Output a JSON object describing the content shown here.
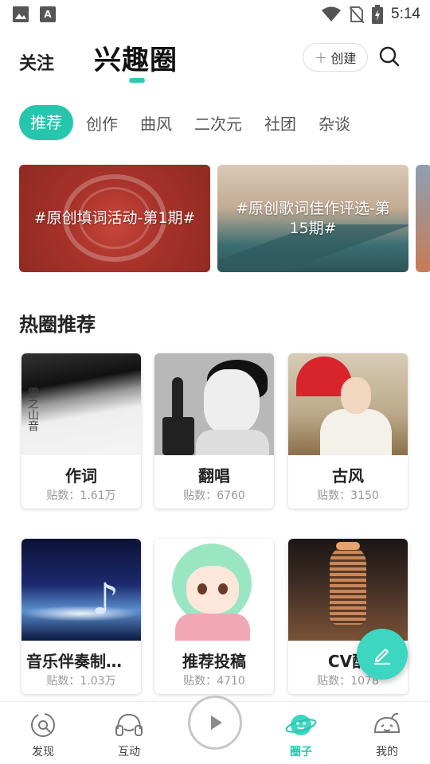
{
  "status_bar": {
    "time": "5:14",
    "left_icons": [
      "image-icon",
      "a-icon"
    ],
    "right_icons": [
      "wifi-icon",
      "no-sim-icon",
      "battery-icon"
    ]
  },
  "header": {
    "tab_follow": "关注",
    "tab_circle": "兴趣圈",
    "create_label": "创建",
    "accent_color": "#25c6ad"
  },
  "categories": [
    "推荐",
    "创作",
    "曲风",
    "二次元",
    "社团",
    "杂谈"
  ],
  "banners": [
    {
      "title": "#原创填词活动-第1期#"
    },
    {
      "title": "#原创歌词佳作评选-第15期#"
    }
  ],
  "section_title": "热圈推荐",
  "cards": [
    {
      "name": "作词",
      "count": "贴数：1.61万"
    },
    {
      "name": "翻唱",
      "count": "贴数：6760"
    },
    {
      "name": "古风",
      "count": "贴数：3150"
    },
    {
      "name": "音乐伴奏制作...",
      "count": "贴数：1.03万"
    },
    {
      "name": "推荐投稿",
      "count": "贴数：4710"
    },
    {
      "name": "CV配",
      "count": "贴数：1078"
    }
  ],
  "nav": [
    {
      "label": "发现",
      "icon": "discover-icon"
    },
    {
      "label": "互动",
      "icon": "interact-icon"
    },
    {
      "label": "",
      "icon": "play-icon"
    },
    {
      "label": "圈子",
      "icon": "circle-icon"
    },
    {
      "label": "我的",
      "icon": "profile-icon"
    }
  ]
}
